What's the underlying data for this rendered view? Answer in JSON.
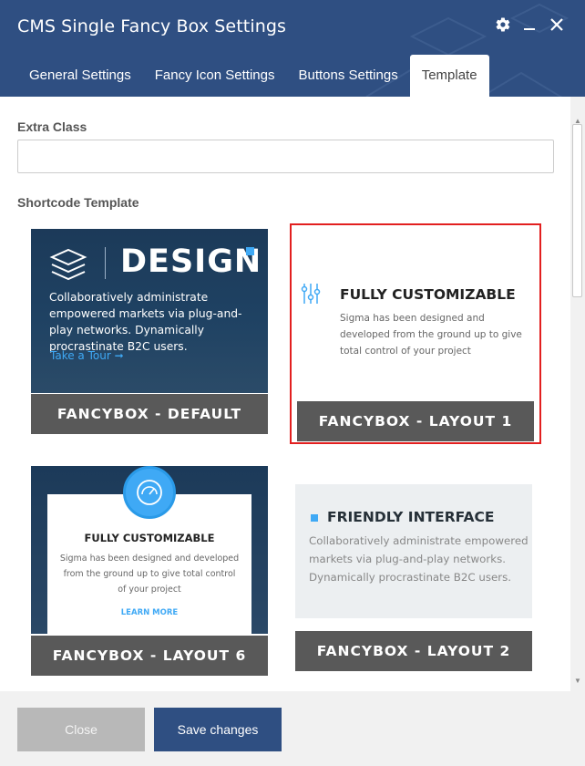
{
  "window": {
    "title": "CMS Single Fancy Box Settings"
  },
  "tabs": [
    {
      "label": "General Settings",
      "active": false
    },
    {
      "label": "Fancy Icon Settings",
      "active": false
    },
    {
      "label": "Buttons Settings",
      "active": false
    },
    {
      "label": "Template",
      "active": true
    }
  ],
  "fields": {
    "extra_class": {
      "label": "Extra Class",
      "value": ""
    },
    "shortcode_template": {
      "label": "Shortcode Template"
    }
  },
  "templates": {
    "default": {
      "name": "FANCYBOX - DEFAULT",
      "preview_heading": "DESIGN",
      "preview_text": "Collaboratively administrate empowered markets via plug-and-play networks. Dynamically procrastinate B2C users.",
      "preview_link": "Take a Tour ➞"
    },
    "layout1": {
      "name": "FANCYBOX - LAYOUT 1",
      "selected": true,
      "preview_heading": "FULLY CUSTOMIZABLE",
      "preview_text": "Sigma has been designed and developed from the ground up to give total control of your project"
    },
    "layout6": {
      "name": "FANCYBOX - LAYOUT 6",
      "preview_heading": "FULLY CUSTOMIZABLE",
      "preview_text": "Sigma has been designed and developed from the ground up to give total control of your project",
      "preview_link": "LEARN MORE"
    },
    "layout2": {
      "name": "FANCYBOX - LAYOUT 2",
      "preview_heading": "FRIENDLY INTERFACE",
      "preview_text": "Collaboratively administrate empowered markets via plug-and-play networks. Dynamically procrastinate B2C users."
    }
  },
  "footer": {
    "close_label": "Close",
    "save_label": "Save changes"
  },
  "colors": {
    "header_bg": "#2f4f82",
    "accent": "#3fa9f5",
    "selection_border": "#e21f1f",
    "label_bg": "#595959",
    "save_button": "#2f4f82",
    "close_button": "#b8b8b8"
  }
}
